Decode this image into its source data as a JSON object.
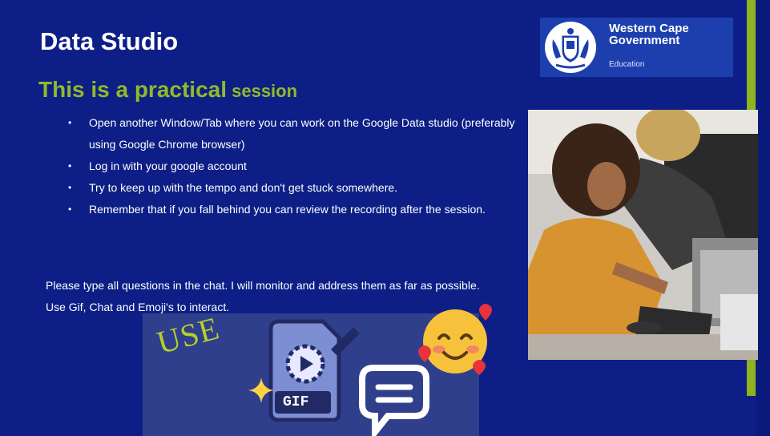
{
  "slide": {
    "title": "Data Studio",
    "subtitle_part1": "This is a practical",
    "subtitle_part2": " session"
  },
  "logo": {
    "line1": "Western Cape",
    "line2": "Government",
    "line3": "Education"
  },
  "bullets": [
    "Open another Window/Tab where you can work on the Google Data studio (preferably using Google Chrome browser)",
    "Log in with your google account",
    "Try to keep up with the tempo and don't get stuck somewhere.",
    "Remember that if you fall behind you can review the recording after the session."
  ],
  "note": "Please type all questions in the chat. I will monitor and address them as far as possible. Use Gif, Chat and Emoji's to interact.",
  "graphic": {
    "use_text": "USE",
    "gif_label": "GIF"
  },
  "colors": {
    "background": "#0d1f86",
    "accent_green": "#92b92a",
    "logo_bg": "#1d3fae"
  },
  "icons": [
    "crest-icon",
    "gif-file-icon",
    "chat-bubble-icon",
    "sparkle-icon",
    "smiling-face-with-hearts-icon"
  ]
}
